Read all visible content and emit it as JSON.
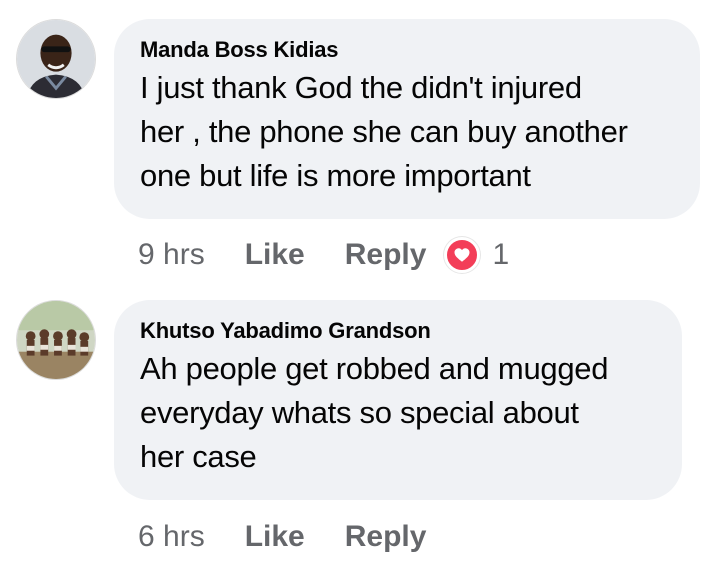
{
  "comments": [
    {
      "author": "Manda Boss Kidias",
      "text_lines": [
        "I just thank God the didn't injured",
        "her , the phone she can buy another",
        "one but life is more important"
      ],
      "time": "9 hrs",
      "like_label": "Like",
      "reply_label": "Reply",
      "reaction": {
        "icon": "heart-icon",
        "count": "1",
        "color": "#f33e58"
      }
    },
    {
      "author": "Khutso Yabadimo Grandson",
      "text_lines": [
        "Ah people get robbed and mugged",
        "everyday whats so special about",
        "her case"
      ],
      "time": "6 hrs",
      "like_label": "Like",
      "reply_label": "Reply"
    }
  ],
  "colors": {
    "bubble": "#f0f2f5",
    "secondary_text": "#65676b",
    "primary_text": "#050505"
  }
}
